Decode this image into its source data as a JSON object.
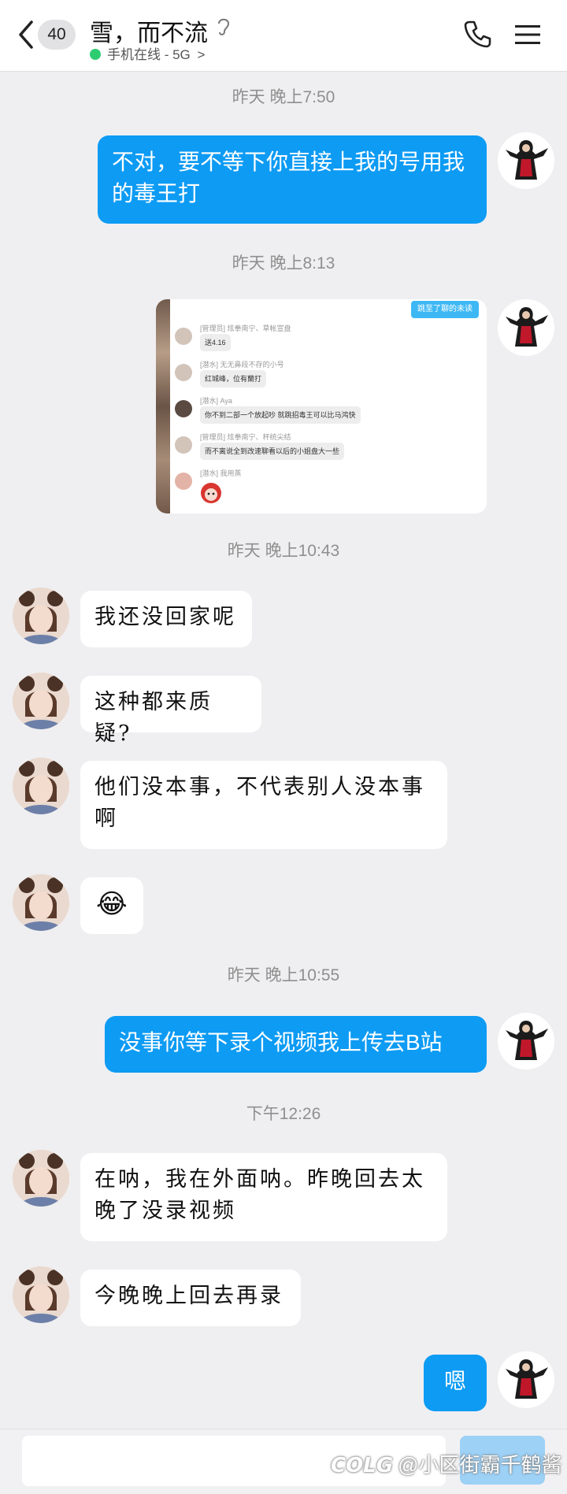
{
  "header": {
    "back_badge": "40",
    "title": "雪，而不流",
    "status": "手机在线 - 5G",
    "status_chevron": ">",
    "phone_icon": "phone-icon",
    "menu_icon": "menu-icon"
  },
  "messages": [
    {
      "type": "time",
      "text": "昨天 晚上7:50"
    },
    {
      "type": "text",
      "side": "out",
      "text": "不对，要不等下你直接上我的号用我的毒王打"
    },
    {
      "type": "time",
      "text": "昨天 晚上8:13"
    },
    {
      "type": "image",
      "side": "out",
      "tag": "跳至了聊的未读",
      "rows": [
        {
          "name": "[管理员] 炫拳南宁、草帐宣盘",
          "msg": "送4.16"
        },
        {
          "name": "[潜水] 无无鼻段不存的小号",
          "msg": "红城峰，位有蘭打"
        },
        {
          "name": "[潜水] Aya",
          "msg": "你不到二部一个放起吵 就跳招毒王可以比马鸿快"
        },
        {
          "name": "[管理员] 炫拳南宁、杯统尖结",
          "msg": "而不离说全到改速聊看以后的小姐盘大一些"
        },
        {
          "name": "[潜水] 我用蒸",
          "msg": ""
        }
      ]
    },
    {
      "type": "time",
      "text": "昨天 晚上10:43"
    },
    {
      "type": "text",
      "side": "in",
      "text": "我还没回家呢"
    },
    {
      "type": "text",
      "side": "in",
      "text": "这种都来质疑?"
    },
    {
      "type": "text",
      "side": "in",
      "text": "他们没本事，不代表别人没本事啊"
    },
    {
      "type": "emoji",
      "side": "in",
      "text": "😂"
    },
    {
      "type": "time",
      "text": "昨天 晚上10:55"
    },
    {
      "type": "text",
      "side": "out",
      "text": "没事你等下录个视频我上传去B站"
    },
    {
      "type": "time",
      "text": "下午12:26"
    },
    {
      "type": "text",
      "side": "in",
      "text": "在呐，我在外面呐。昨晚回去太晚了没录视频"
    },
    {
      "type": "text",
      "side": "in",
      "text": "今晚晚上回去再录"
    },
    {
      "type": "text",
      "side": "out",
      "text": "嗯"
    }
  ],
  "input": {
    "placeholder": "",
    "send_label": ""
  },
  "watermark": {
    "logo": "COLG",
    "text": "@小区街霸千鹤酱"
  },
  "colors": {
    "outgoing_bubble": "#0d9bf4",
    "incoming_bubble": "#ffffff",
    "background": "#efeff1",
    "online_dot": "#2ecc71"
  }
}
